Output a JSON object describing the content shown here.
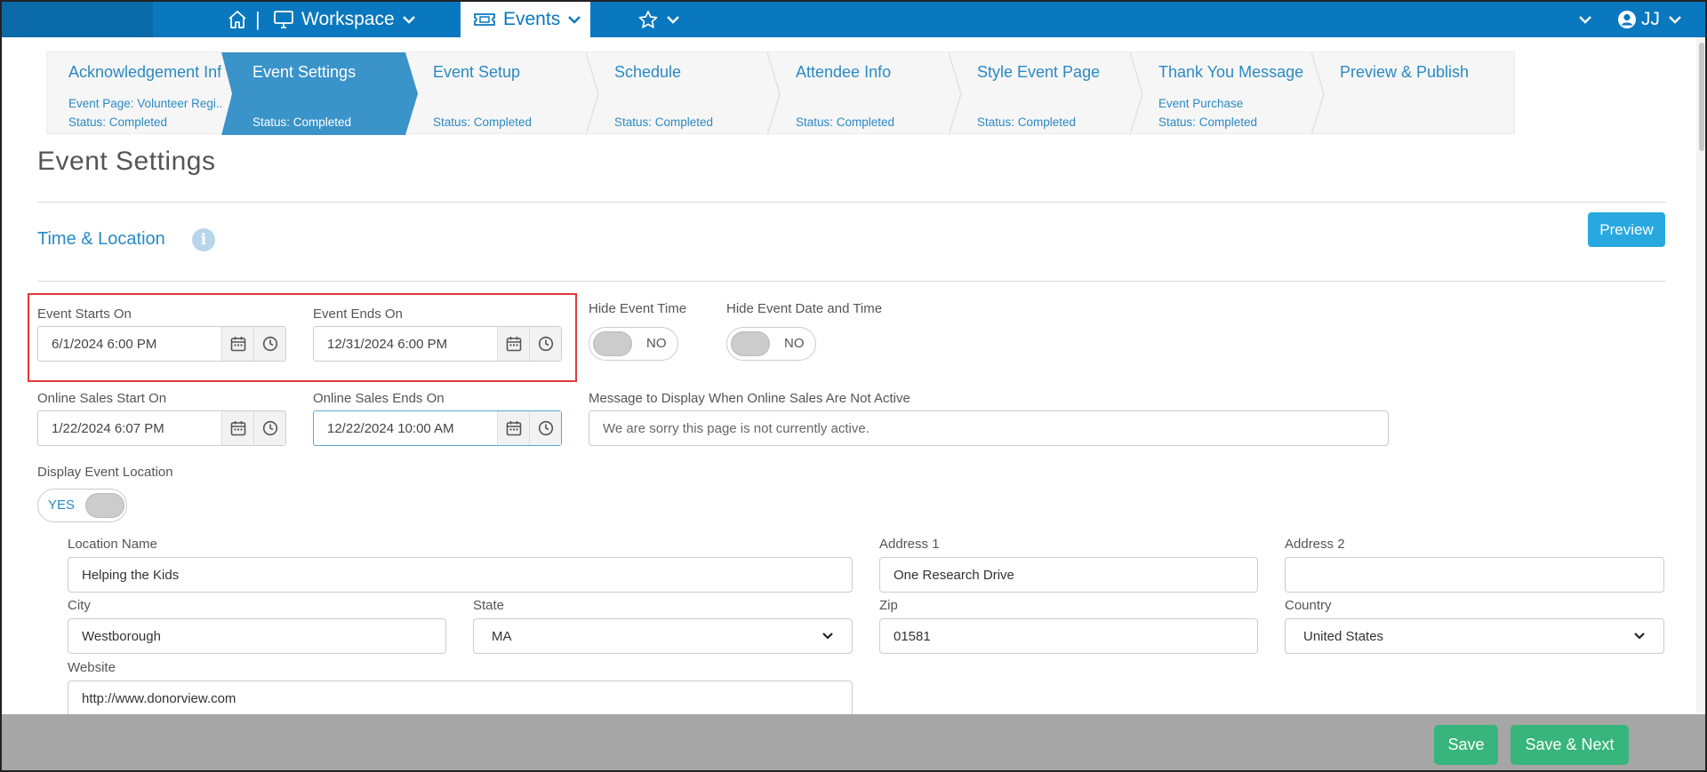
{
  "topnav": {
    "workspace_label": "Workspace",
    "events_label": "Events",
    "separator": "|",
    "user_initials": "JJ"
  },
  "wizard": {
    "steps": [
      {
        "title": "Acknowledgement Info",
        "sub1": "Event Page: Volunteer Regi...",
        "sub2": "Status: Completed"
      },
      {
        "title": "Event Settings",
        "sub1": "",
        "sub2": "Status: Completed"
      },
      {
        "title": "Event Setup",
        "sub1": "",
        "sub2": "Status: Completed"
      },
      {
        "title": "Schedule",
        "sub1": "",
        "sub2": "Status: Completed"
      },
      {
        "title": "Attendee Info",
        "sub1": "",
        "sub2": "Status: Completed"
      },
      {
        "title": "Style Event Page",
        "sub1": "",
        "sub2": "Status: Completed"
      },
      {
        "title": "Thank You Message",
        "sub1": "Event Purchase",
        "sub2": "Status: Completed"
      },
      {
        "title": "Preview & Publish",
        "sub1": "",
        "sub2": ""
      }
    ],
    "active_index": 1
  },
  "page": {
    "title": "Event Settings",
    "section_title": "Time & Location",
    "preview_label": "Preview"
  },
  "fields": {
    "event_starts_label": "Event Starts On",
    "event_starts_value": "6/1/2024 6:00 PM",
    "event_ends_label": "Event Ends On",
    "event_ends_value": "12/31/2024 6:00 PM",
    "hide_event_time_label": "Hide Event Time",
    "hide_event_time_state": "NO",
    "hide_event_datetime_label": "Hide Event Date and Time",
    "hide_event_datetime_state": "NO",
    "sales_start_label": "Online Sales Start On",
    "sales_start_value": "1/22/2024 6:07 PM",
    "sales_end_label": "Online Sales Ends On",
    "sales_end_value": "12/22/2024 10:00 AM",
    "inactive_message_label": "Message to Display When Online Sales Are Not Active",
    "inactive_message_value": "We are sorry this page is not currently active.",
    "display_location_label": "Display Event Location",
    "display_location_state": "YES"
  },
  "location": {
    "name_label": "Location Name",
    "name_value": "Helping the Kids",
    "address1_label": "Address 1",
    "address1_value": "One Research Drive",
    "address2_label": "Address 2",
    "address2_value": "",
    "city_label": "City",
    "city_value": "Westborough",
    "state_label": "State",
    "state_value": "MA",
    "zip_label": "Zip",
    "zip_value": "01581",
    "country_label": "Country",
    "country_value": "United States",
    "website_label": "Website",
    "website_value": "http://www.donorview.com"
  },
  "footer": {
    "save_label": "Save",
    "save_next_label": "Save & Next"
  },
  "colors": {
    "nav_blue": "#0a78bf",
    "active_step": "#3a93c9",
    "link_blue": "#2a8ac4",
    "preview_button": "#29a8e0",
    "save_green": "#37b57c",
    "highlight_red": "#e0393e"
  }
}
